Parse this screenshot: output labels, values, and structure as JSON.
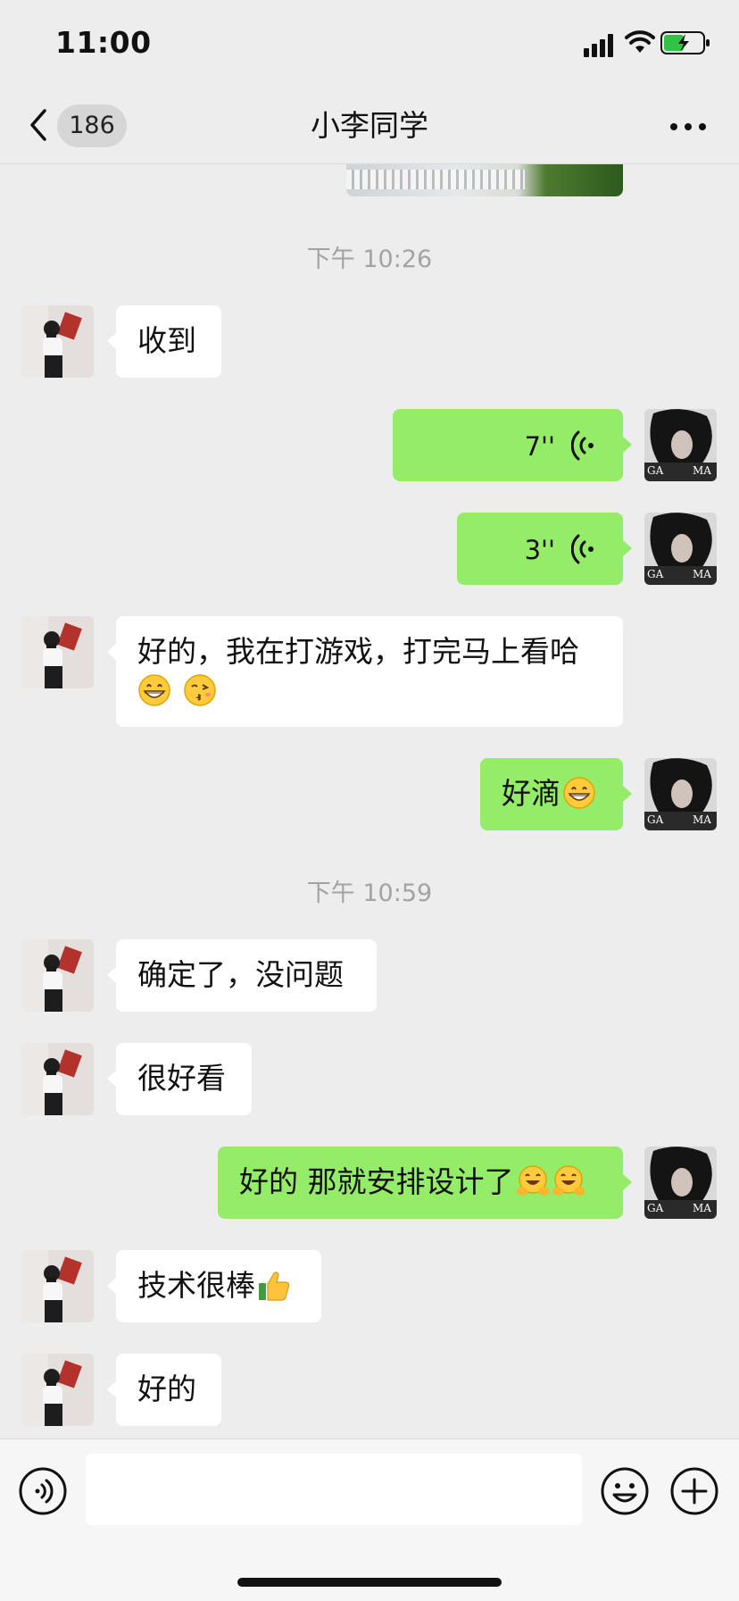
{
  "status_bar": {
    "time": "11:00"
  },
  "nav": {
    "unread_count": "186",
    "title": "小李同学"
  },
  "chat": {
    "timestamps": [
      "下午 10:26",
      "下午 10:59"
    ],
    "messages": [
      {
        "side": "in",
        "type": "text",
        "text": "收到"
      },
      {
        "side": "out",
        "type": "voice",
        "duration": "7''"
      },
      {
        "side": "out",
        "type": "voice",
        "duration": "3''"
      },
      {
        "side": "in",
        "type": "text",
        "text_line1": "好的，我在打游戏，打完马上看哈",
        "emojis": [
          "grin-emoji",
          "kiss-emoji"
        ]
      },
      {
        "side": "out",
        "type": "text",
        "text": "好滴",
        "emojis": [
          "grin-emoji"
        ]
      },
      {
        "side": "in",
        "type": "text",
        "text": "确定了，没问题"
      },
      {
        "side": "in",
        "type": "text",
        "text": "很好看"
      },
      {
        "side": "out",
        "type": "text",
        "text": "好的 那就安排设计了",
        "emojis": [
          "hug-emoji",
          "hug-emoji"
        ]
      },
      {
        "side": "in",
        "type": "text",
        "text": "技术很棒",
        "emojis": [
          "thumbs-up-emoji"
        ]
      },
      {
        "side": "in",
        "type": "text",
        "text": "好的"
      }
    ]
  },
  "self_avatar": {
    "label_left": "GA",
    "label_right": "MA"
  },
  "input_bar": {
    "placeholder": ""
  },
  "colors": {
    "background": "#ededed",
    "outgoing_bubble": "#95ec69",
    "incoming_bubble": "#ffffff",
    "timestamp": "#a3a3a3"
  }
}
